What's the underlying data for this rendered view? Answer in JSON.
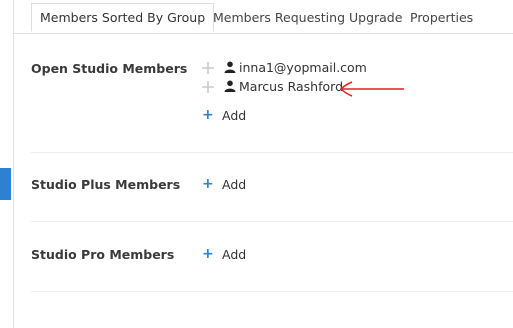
{
  "tabs": [
    {
      "label": "Members Sorted By Group",
      "active": true
    },
    {
      "label": "Members Requesting Upgrade",
      "active": false
    },
    {
      "label": "Properties",
      "active": false
    }
  ],
  "groups": [
    {
      "title": "Open Studio Members",
      "members": [
        "inna1@yopmail.com",
        "Marcus Rashford"
      ],
      "add_label": "Add"
    },
    {
      "title": "Studio Plus Members",
      "members": [],
      "add_label": "Add"
    },
    {
      "title": "Studio Pro Members",
      "members": [],
      "add_label": "Add"
    }
  ],
  "icons": {
    "drag": "drag-handle-icon",
    "member": "user-icon",
    "add": "plus-icon",
    "annotation": "red-arrow-annotation"
  },
  "colors": {
    "accent": "#2f80d1",
    "annotation": "#e02020",
    "divider": "#ececec"
  }
}
